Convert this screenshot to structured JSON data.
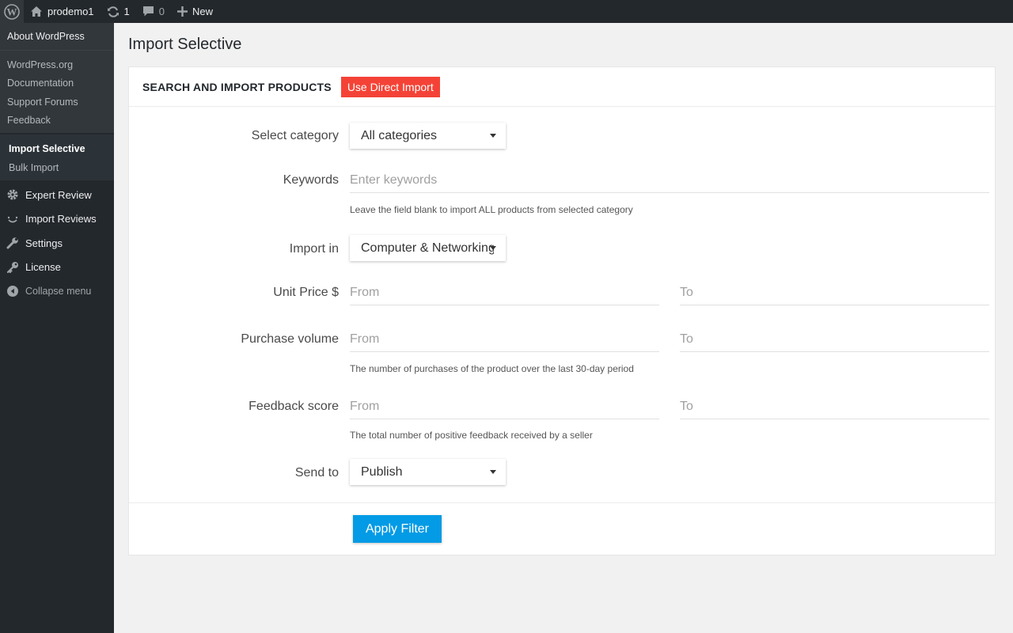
{
  "adminbar": {
    "site_name": "prodemo1",
    "updates_count": "1",
    "comments_count": "0",
    "new_label": "New"
  },
  "sidebar": {
    "top_item": "About WordPress",
    "wp_links": [
      "WordPress.org",
      "Documentation",
      "Support Forums",
      "Feedback"
    ],
    "plugin_submenu": [
      {
        "label": "Import Selective",
        "current": true
      },
      {
        "label": "Bulk Import",
        "current": false
      }
    ],
    "menu": [
      {
        "label": "Expert Review",
        "icon": "gear-icon"
      },
      {
        "label": "Import Reviews",
        "icon": "smile-icon"
      },
      {
        "label": "Settings",
        "icon": "wrench-icon"
      },
      {
        "label": "License",
        "icon": "key-icon"
      }
    ],
    "collapse_label": "Collapse menu"
  },
  "page": {
    "title": "Import Selective"
  },
  "panel": {
    "title": "SEARCH AND IMPORT PRODUCTS",
    "direct_import_label": "Use Direct Import",
    "category": {
      "label": "Select category",
      "value": "All categories"
    },
    "keywords": {
      "label": "Keywords",
      "placeholder": "Enter keywords",
      "help": "Leave the field blank to import ALL products from selected category"
    },
    "import_in": {
      "label": "Import in",
      "value": "Computer & Networking"
    },
    "unit_price": {
      "label": "Unit Price $",
      "from_placeholder": "From",
      "to_placeholder": "To"
    },
    "purchase_volume": {
      "label": "Purchase volume",
      "from_placeholder": "From",
      "to_placeholder": "To",
      "help": "The number of purchases of the product over the last 30-day period"
    },
    "feedback_score": {
      "label": "Feedback score",
      "from_placeholder": "From",
      "to_placeholder": "To",
      "help": "The total number of positive feedback received by a seller"
    },
    "send_to": {
      "label": "Send to",
      "value": "Publish"
    },
    "apply_label": "Apply Filter"
  },
  "colors": {
    "direct_button": "#f44336",
    "apply_button": "#039be5",
    "adminbar": "#23282d"
  }
}
